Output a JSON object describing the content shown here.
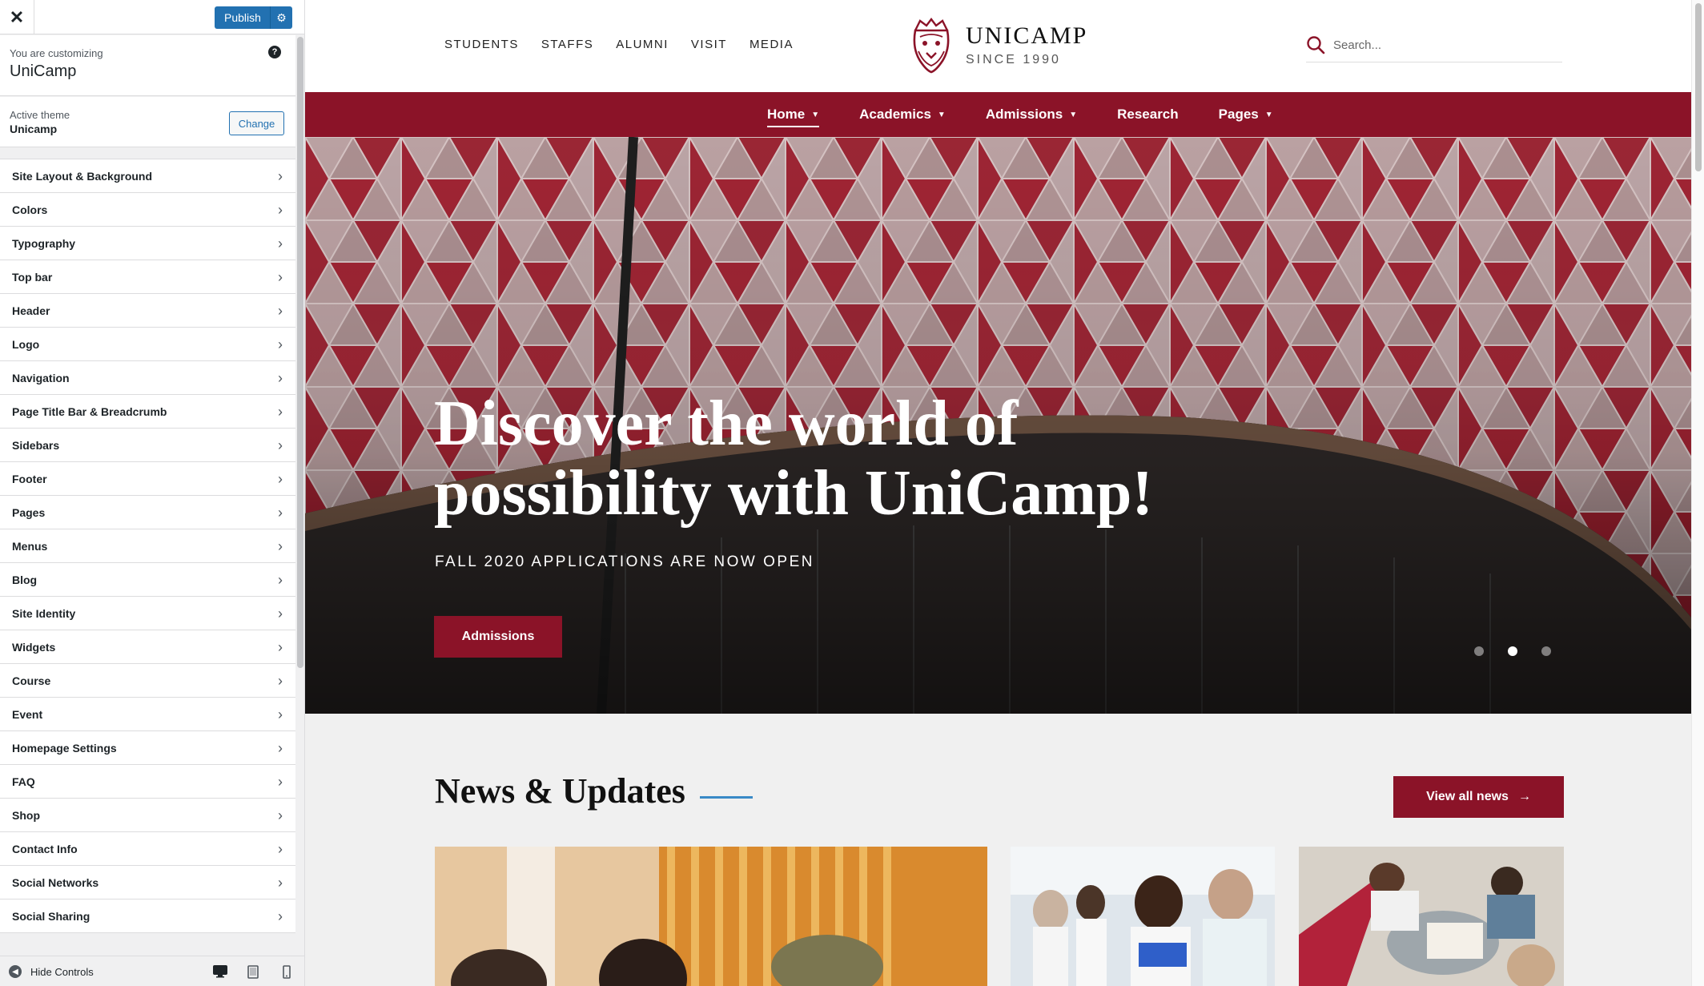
{
  "customizer": {
    "publish_label": "Publish",
    "customizing_label": "You are customizing",
    "site_name": "UniCamp",
    "active_theme_label": "Active theme",
    "active_theme_name": "Unicamp",
    "change_label": "Change",
    "menu": [
      {
        "label": "Site Layout & Background"
      },
      {
        "label": "Colors"
      },
      {
        "label": "Typography"
      },
      {
        "label": "Top bar"
      },
      {
        "label": "Header"
      },
      {
        "label": "Logo"
      },
      {
        "label": "Navigation"
      },
      {
        "label": "Page Title Bar & Breadcrumb"
      },
      {
        "label": "Sidebars"
      },
      {
        "label": "Footer"
      },
      {
        "label": "Pages"
      },
      {
        "label": "Menus"
      },
      {
        "label": "Blog"
      },
      {
        "label": "Site Identity"
      },
      {
        "label": "Widgets"
      },
      {
        "label": "Course"
      },
      {
        "label": "Event"
      },
      {
        "label": "Homepage Settings"
      },
      {
        "label": "FAQ"
      },
      {
        "label": "Shop"
      },
      {
        "label": "Contact Info"
      },
      {
        "label": "Social Networks"
      },
      {
        "label": "Social Sharing"
      }
    ],
    "hide_controls_label": "Hide Controls",
    "accent_color": "#2271b1"
  },
  "site": {
    "top_links": [
      "STUDENTS",
      "STAFFS",
      "ALUMNI",
      "VISIT",
      "MEDIA"
    ],
    "logo_title": "UNICAMP",
    "logo_sub": "SINCE 1990",
    "search_placeholder": "Search...",
    "nav": [
      {
        "label": "Home",
        "has_dropdown": true,
        "active": true
      },
      {
        "label": "Academics",
        "has_dropdown": true
      },
      {
        "label": "Admissions",
        "has_dropdown": true
      },
      {
        "label": "Research",
        "has_dropdown": false
      },
      {
        "label": "Pages",
        "has_dropdown": true
      }
    ],
    "hero": {
      "title_line1": "Discover the world of",
      "title_line2": "possibility with UniCamp!",
      "subtitle": "FALL 2020 APPLICATIONS ARE NOW OPEN",
      "button_label": "Admissions",
      "active_slide": 2,
      "slide_count": 3
    },
    "news": {
      "title": "News & Updates",
      "view_all_label": "View all news"
    },
    "brand_color": "#8b1328"
  }
}
